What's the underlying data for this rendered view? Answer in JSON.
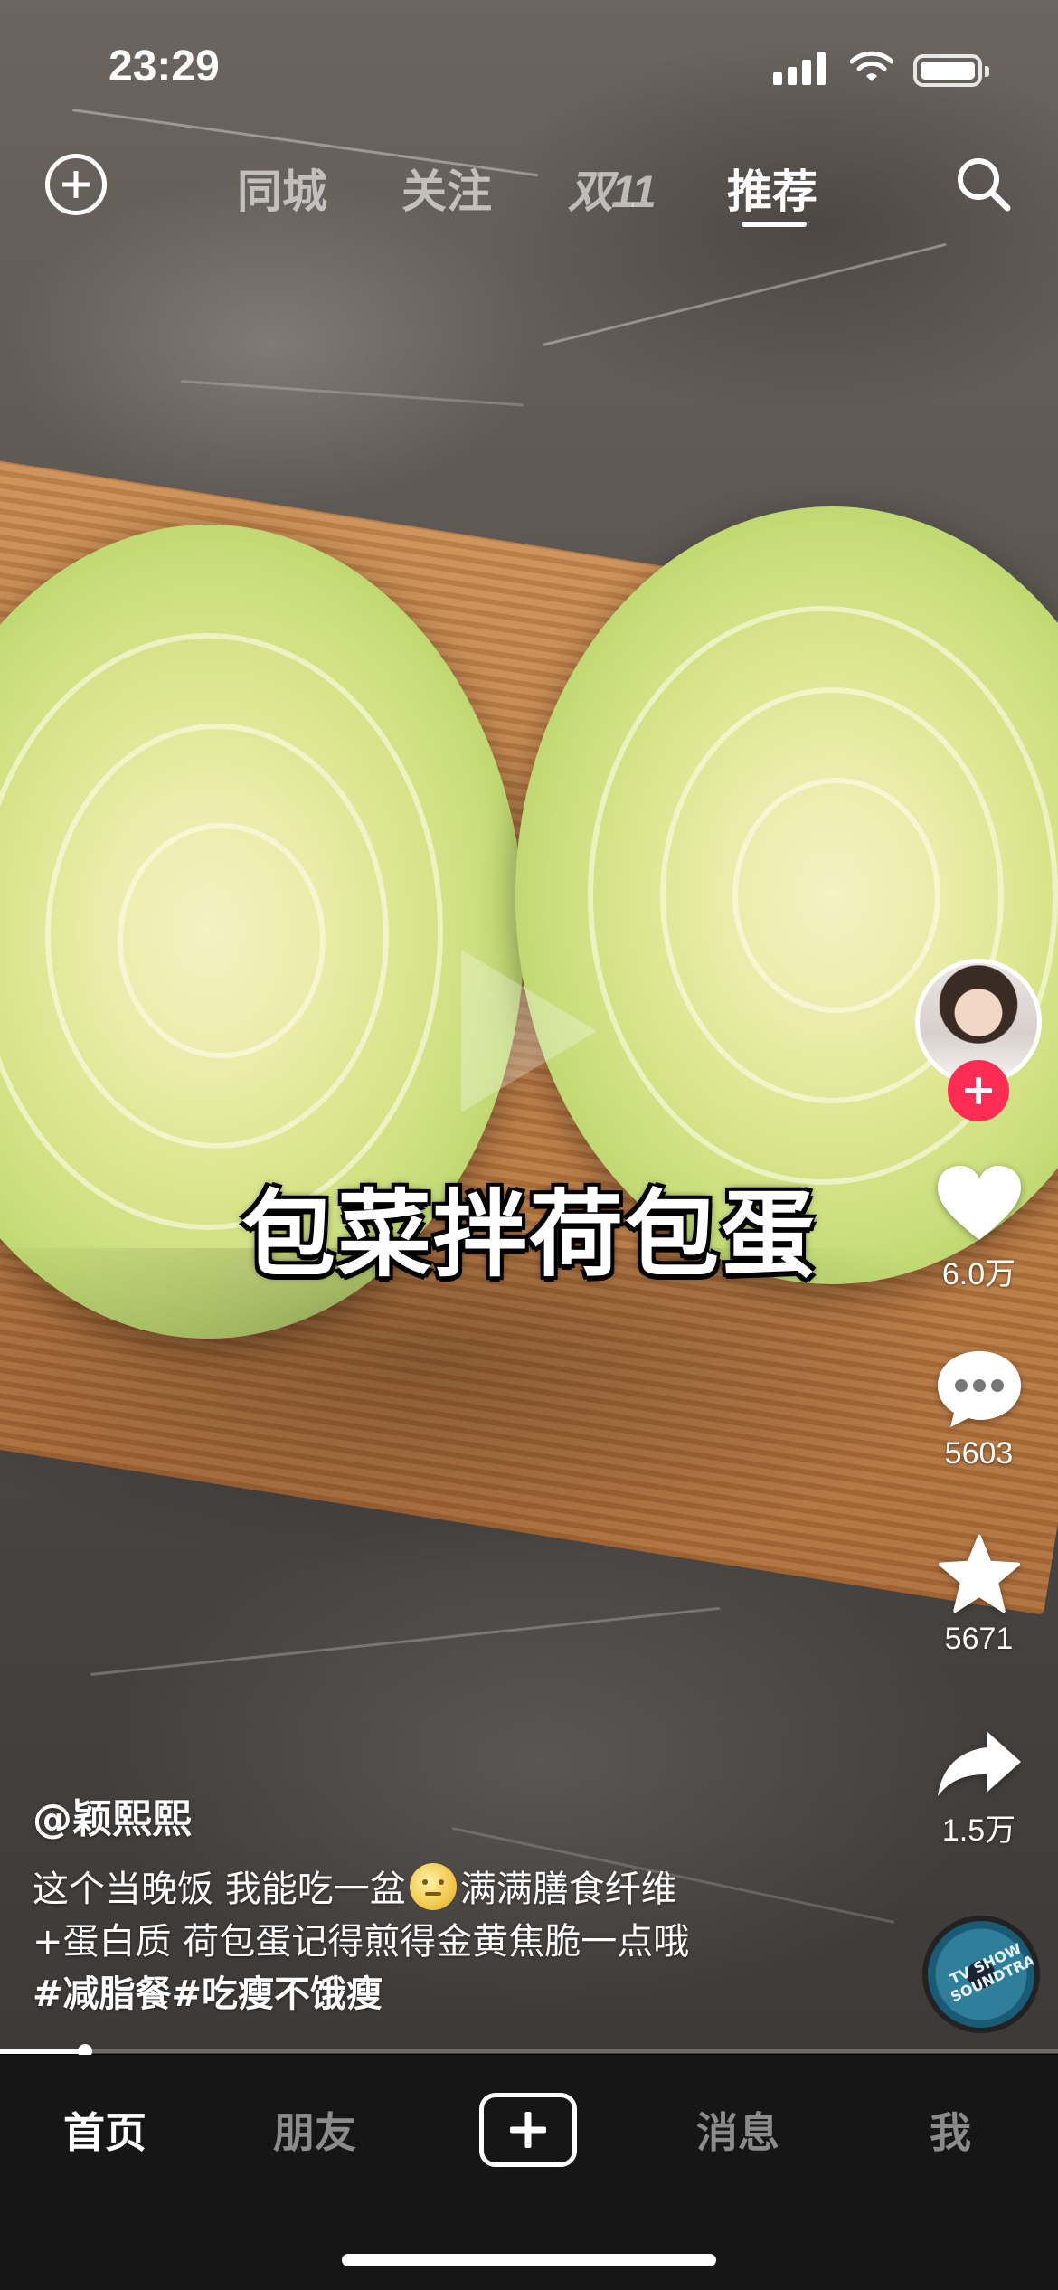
{
  "status_bar": {
    "time": "23:29",
    "signal_icon": "signal-icon",
    "wifi_icon": "wifi-icon",
    "battery_icon": "battery-icon"
  },
  "top_nav": {
    "add_icon": "add-circle-icon",
    "tabs": [
      {
        "label": "同城",
        "active": false
      },
      {
        "label": "关注",
        "active": false
      },
      {
        "label": "双11",
        "active": false
      },
      {
        "label": "推荐",
        "active": true
      }
    ],
    "search_icon": "search-icon"
  },
  "video": {
    "caption": "包菜拌荷包蛋",
    "progress": 0.08
  },
  "sidebar": {
    "avatar_icon": "avatar",
    "follow_icon": "plus-icon",
    "like_count": "6.0万",
    "comment_count": "5603",
    "favorite_count": "5671",
    "share_count": "1.5万",
    "music_disc_text": "TV SHOW SOUNDTRACKS"
  },
  "post": {
    "author": "@颖熙熙",
    "description_line1_a": "这个当晚饭  我能吃一盆",
    "description_line1_b": "满满膳食纤维",
    "description_line2": "+蛋白质 荷包蛋记得煎得金黄焦脆一点哦",
    "hashtags": "#减脂餐#吃瘦不饿瘦"
  },
  "bottom_nav": {
    "items": [
      {
        "label": "首页",
        "active": true
      },
      {
        "label": "朋友",
        "active": false
      },
      {
        "label": "消息",
        "active": false
      },
      {
        "label": "我",
        "active": false
      }
    ],
    "create_icon": "create-plus-icon"
  },
  "colors": {
    "accent": "#ff2c55",
    "nav_bg": "#161616"
  }
}
